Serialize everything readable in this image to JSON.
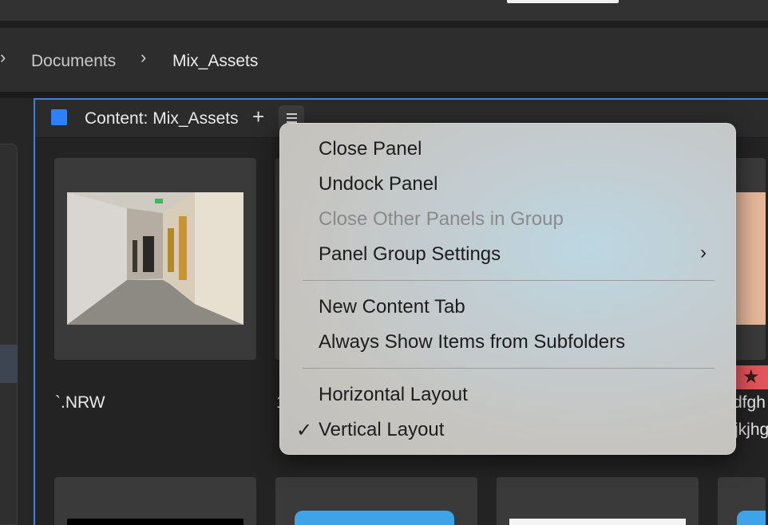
{
  "breadcrumb": {
    "items": [
      {
        "label": "Documents"
      },
      {
        "label": "Mix_Assets"
      }
    ],
    "separator": "›"
  },
  "panel": {
    "title": "Content: Mix_Assets",
    "add_symbol": "+",
    "square_color": "#2f80ff",
    "border_color": "#3f7fd4"
  },
  "thumbnails": [
    {
      "label": "`.NRW"
    },
    {
      "label": "1"
    },
    {
      "label": ""
    },
    {
      "label": "dfgh"
    },
    {
      "label": "jkjhg"
    }
  ],
  "context_menu": {
    "groups": [
      [
        {
          "label": "Close Panel",
          "enabled": true
        },
        {
          "label": "Undock Panel",
          "enabled": true
        },
        {
          "label": "Close Other Panels in Group",
          "enabled": false
        },
        {
          "label": "Panel Group Settings",
          "enabled": true,
          "submenu": true
        }
      ],
      [
        {
          "label": "New Content Tab",
          "enabled": true
        },
        {
          "label": "Always Show Items from Subfolders",
          "enabled": true
        }
      ],
      [
        {
          "label": "Horizontal Layout",
          "enabled": true
        },
        {
          "label": "Vertical Layout",
          "enabled": true,
          "checked": true
        }
      ]
    ],
    "submenu_chevron": "›",
    "check_mark": "✓"
  },
  "colors": {
    "accent_blue": "#3f7fd4",
    "rating_red": "#e2545a"
  }
}
